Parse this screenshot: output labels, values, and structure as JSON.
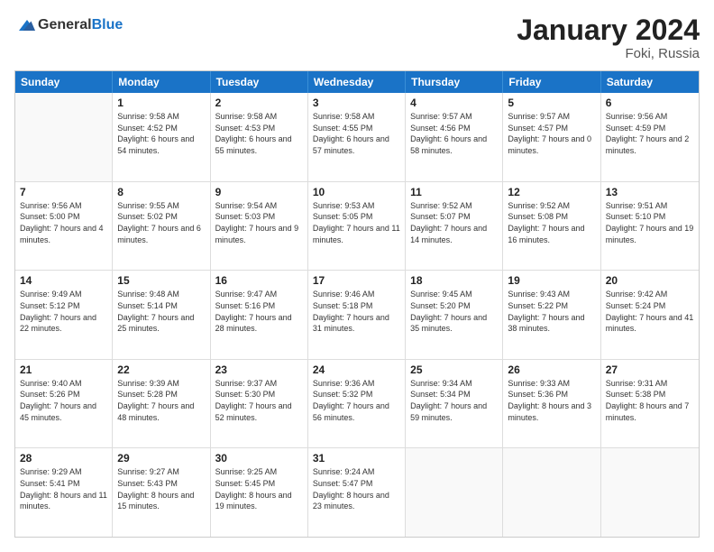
{
  "logo": {
    "general": "General",
    "blue": "Blue"
  },
  "title": "January 2024",
  "location": "Foki, Russia",
  "header_days": [
    "Sunday",
    "Monday",
    "Tuesday",
    "Wednesday",
    "Thursday",
    "Friday",
    "Saturday"
  ],
  "weeks": [
    [
      {
        "day": "",
        "sunrise": "",
        "sunset": "",
        "daylight": ""
      },
      {
        "day": "1",
        "sunrise": "Sunrise: 9:58 AM",
        "sunset": "Sunset: 4:52 PM",
        "daylight": "Daylight: 6 hours and 54 minutes."
      },
      {
        "day": "2",
        "sunrise": "Sunrise: 9:58 AM",
        "sunset": "Sunset: 4:53 PM",
        "daylight": "Daylight: 6 hours and 55 minutes."
      },
      {
        "day": "3",
        "sunrise": "Sunrise: 9:58 AM",
        "sunset": "Sunset: 4:55 PM",
        "daylight": "Daylight: 6 hours and 57 minutes."
      },
      {
        "day": "4",
        "sunrise": "Sunrise: 9:57 AM",
        "sunset": "Sunset: 4:56 PM",
        "daylight": "Daylight: 6 hours and 58 minutes."
      },
      {
        "day": "5",
        "sunrise": "Sunrise: 9:57 AM",
        "sunset": "Sunset: 4:57 PM",
        "daylight": "Daylight: 7 hours and 0 minutes."
      },
      {
        "day": "6",
        "sunrise": "Sunrise: 9:56 AM",
        "sunset": "Sunset: 4:59 PM",
        "daylight": "Daylight: 7 hours and 2 minutes."
      }
    ],
    [
      {
        "day": "7",
        "sunrise": "Sunrise: 9:56 AM",
        "sunset": "Sunset: 5:00 PM",
        "daylight": "Daylight: 7 hours and 4 minutes."
      },
      {
        "day": "8",
        "sunrise": "Sunrise: 9:55 AM",
        "sunset": "Sunset: 5:02 PM",
        "daylight": "Daylight: 7 hours and 6 minutes."
      },
      {
        "day": "9",
        "sunrise": "Sunrise: 9:54 AM",
        "sunset": "Sunset: 5:03 PM",
        "daylight": "Daylight: 7 hours and 9 minutes."
      },
      {
        "day": "10",
        "sunrise": "Sunrise: 9:53 AM",
        "sunset": "Sunset: 5:05 PM",
        "daylight": "Daylight: 7 hours and 11 minutes."
      },
      {
        "day": "11",
        "sunrise": "Sunrise: 9:52 AM",
        "sunset": "Sunset: 5:07 PM",
        "daylight": "Daylight: 7 hours and 14 minutes."
      },
      {
        "day": "12",
        "sunrise": "Sunrise: 9:52 AM",
        "sunset": "Sunset: 5:08 PM",
        "daylight": "Daylight: 7 hours and 16 minutes."
      },
      {
        "day": "13",
        "sunrise": "Sunrise: 9:51 AM",
        "sunset": "Sunset: 5:10 PM",
        "daylight": "Daylight: 7 hours and 19 minutes."
      }
    ],
    [
      {
        "day": "14",
        "sunrise": "Sunrise: 9:49 AM",
        "sunset": "Sunset: 5:12 PM",
        "daylight": "Daylight: 7 hours and 22 minutes."
      },
      {
        "day": "15",
        "sunrise": "Sunrise: 9:48 AM",
        "sunset": "Sunset: 5:14 PM",
        "daylight": "Daylight: 7 hours and 25 minutes."
      },
      {
        "day": "16",
        "sunrise": "Sunrise: 9:47 AM",
        "sunset": "Sunset: 5:16 PM",
        "daylight": "Daylight: 7 hours and 28 minutes."
      },
      {
        "day": "17",
        "sunrise": "Sunrise: 9:46 AM",
        "sunset": "Sunset: 5:18 PM",
        "daylight": "Daylight: 7 hours and 31 minutes."
      },
      {
        "day": "18",
        "sunrise": "Sunrise: 9:45 AM",
        "sunset": "Sunset: 5:20 PM",
        "daylight": "Daylight: 7 hours and 35 minutes."
      },
      {
        "day": "19",
        "sunrise": "Sunrise: 9:43 AM",
        "sunset": "Sunset: 5:22 PM",
        "daylight": "Daylight: 7 hours and 38 minutes."
      },
      {
        "day": "20",
        "sunrise": "Sunrise: 9:42 AM",
        "sunset": "Sunset: 5:24 PM",
        "daylight": "Daylight: 7 hours and 41 minutes."
      }
    ],
    [
      {
        "day": "21",
        "sunrise": "Sunrise: 9:40 AM",
        "sunset": "Sunset: 5:26 PM",
        "daylight": "Daylight: 7 hours and 45 minutes."
      },
      {
        "day": "22",
        "sunrise": "Sunrise: 9:39 AM",
        "sunset": "Sunset: 5:28 PM",
        "daylight": "Daylight: 7 hours and 48 minutes."
      },
      {
        "day": "23",
        "sunrise": "Sunrise: 9:37 AM",
        "sunset": "Sunset: 5:30 PM",
        "daylight": "Daylight: 7 hours and 52 minutes."
      },
      {
        "day": "24",
        "sunrise": "Sunrise: 9:36 AM",
        "sunset": "Sunset: 5:32 PM",
        "daylight": "Daylight: 7 hours and 56 minutes."
      },
      {
        "day": "25",
        "sunrise": "Sunrise: 9:34 AM",
        "sunset": "Sunset: 5:34 PM",
        "daylight": "Daylight: 7 hours and 59 minutes."
      },
      {
        "day": "26",
        "sunrise": "Sunrise: 9:33 AM",
        "sunset": "Sunset: 5:36 PM",
        "daylight": "Daylight: 8 hours and 3 minutes."
      },
      {
        "day": "27",
        "sunrise": "Sunrise: 9:31 AM",
        "sunset": "Sunset: 5:38 PM",
        "daylight": "Daylight: 8 hours and 7 minutes."
      }
    ],
    [
      {
        "day": "28",
        "sunrise": "Sunrise: 9:29 AM",
        "sunset": "Sunset: 5:41 PM",
        "daylight": "Daylight: 8 hours and 11 minutes."
      },
      {
        "day": "29",
        "sunrise": "Sunrise: 9:27 AM",
        "sunset": "Sunset: 5:43 PM",
        "daylight": "Daylight: 8 hours and 15 minutes."
      },
      {
        "day": "30",
        "sunrise": "Sunrise: 9:25 AM",
        "sunset": "Sunset: 5:45 PM",
        "daylight": "Daylight: 8 hours and 19 minutes."
      },
      {
        "day": "31",
        "sunrise": "Sunrise: 9:24 AM",
        "sunset": "Sunset: 5:47 PM",
        "daylight": "Daylight: 8 hours and 23 minutes."
      },
      {
        "day": "",
        "sunrise": "",
        "sunset": "",
        "daylight": ""
      },
      {
        "day": "",
        "sunrise": "",
        "sunset": "",
        "daylight": ""
      },
      {
        "day": "",
        "sunrise": "",
        "sunset": "",
        "daylight": ""
      }
    ]
  ]
}
